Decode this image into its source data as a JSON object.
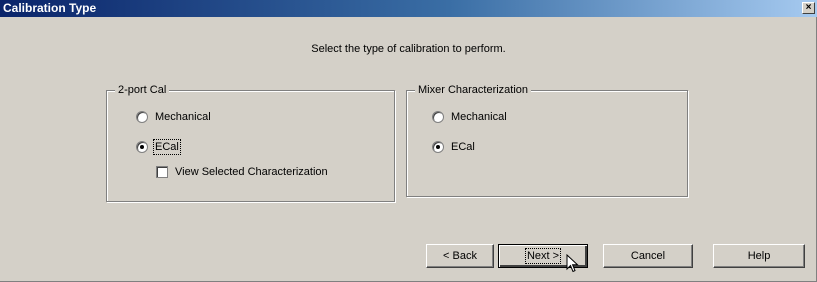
{
  "window": {
    "title": "Calibration Type",
    "close_glyph": "×"
  },
  "instruction": "Select the type of calibration to perform.",
  "two_port_group": {
    "title": "2-port Cal",
    "options": [
      {
        "label": "Mechanical",
        "checked": false
      },
      {
        "label": "ECal",
        "checked": true
      }
    ],
    "checkbox": {
      "label": "View Selected Characterization",
      "checked": false
    }
  },
  "mixer_group": {
    "title": "Mixer Characterization",
    "options": [
      {
        "label": "Mechanical",
        "checked": false
      },
      {
        "label": "ECal",
        "checked": true
      }
    ]
  },
  "buttons": {
    "back": "< Back",
    "next": "Next >",
    "cancel": "Cancel",
    "help": "Help"
  },
  "colors": {
    "titlebar_start": "#0a246a",
    "titlebar_end": "#a6caf0",
    "face": "#d4d0c8"
  }
}
